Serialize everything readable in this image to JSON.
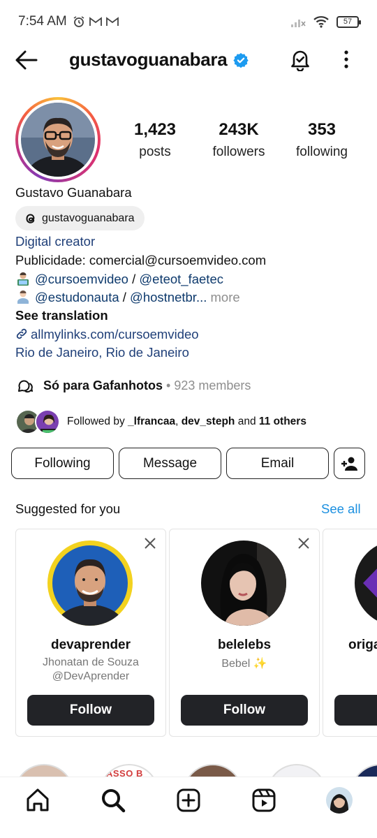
{
  "status_bar": {
    "time": "7:54 AM",
    "battery": "57"
  },
  "header": {
    "username": "gustavoguanabara"
  },
  "stats": [
    {
      "value": "1,423",
      "label": "posts"
    },
    {
      "value": "243K",
      "label": "followers"
    },
    {
      "value": "353",
      "label": "following"
    }
  ],
  "profile": {
    "full_name": "Gustavo Guanabara",
    "threads_handle": "gustavoguanabara",
    "category": "Digital creator",
    "bio_line1": "Publicidade: comercial@cursoemvideo.com",
    "bio_line2_mention1": "@cursoemvideo",
    "bio_line2_sep": " / ",
    "bio_line2_mention2": "@eteot_faetec",
    "bio_line3_mention1": "@estudonauta",
    "bio_line3_sep": " / ",
    "bio_line3_mention2": "@hostnetbr...",
    "bio_more": " more",
    "see_translation": "See translation",
    "link": "allmylinks.com/cursoemvideo",
    "location": "Rio de Janeiro, Rio de Janeiro"
  },
  "community": {
    "name": "Só para Gafanhotos",
    "members": " • 923 members"
  },
  "followed_by": {
    "prefix": "Followed by ",
    "user1": "_lfrancaa",
    "sep": ", ",
    "user2": "dev_steph",
    "and": " and ",
    "others": "11 others"
  },
  "actions": {
    "following": "Following",
    "message": "Message",
    "email": "Email"
  },
  "suggested": {
    "title": "Suggested for you",
    "see_all": "See all",
    "cards": [
      {
        "username": "devaprender",
        "line1": "Jhonatan de Souza",
        "line2": "@DevAprender",
        "follow": "Follow"
      },
      {
        "username": "belelebs",
        "line1": "Bebel ✨",
        "line2": "",
        "follow": "Follow"
      },
      {
        "username": "origa",
        "line1": "",
        "line2": "",
        "follow": ""
      }
    ]
  },
  "highlight_peek_text": "ASSO B"
}
